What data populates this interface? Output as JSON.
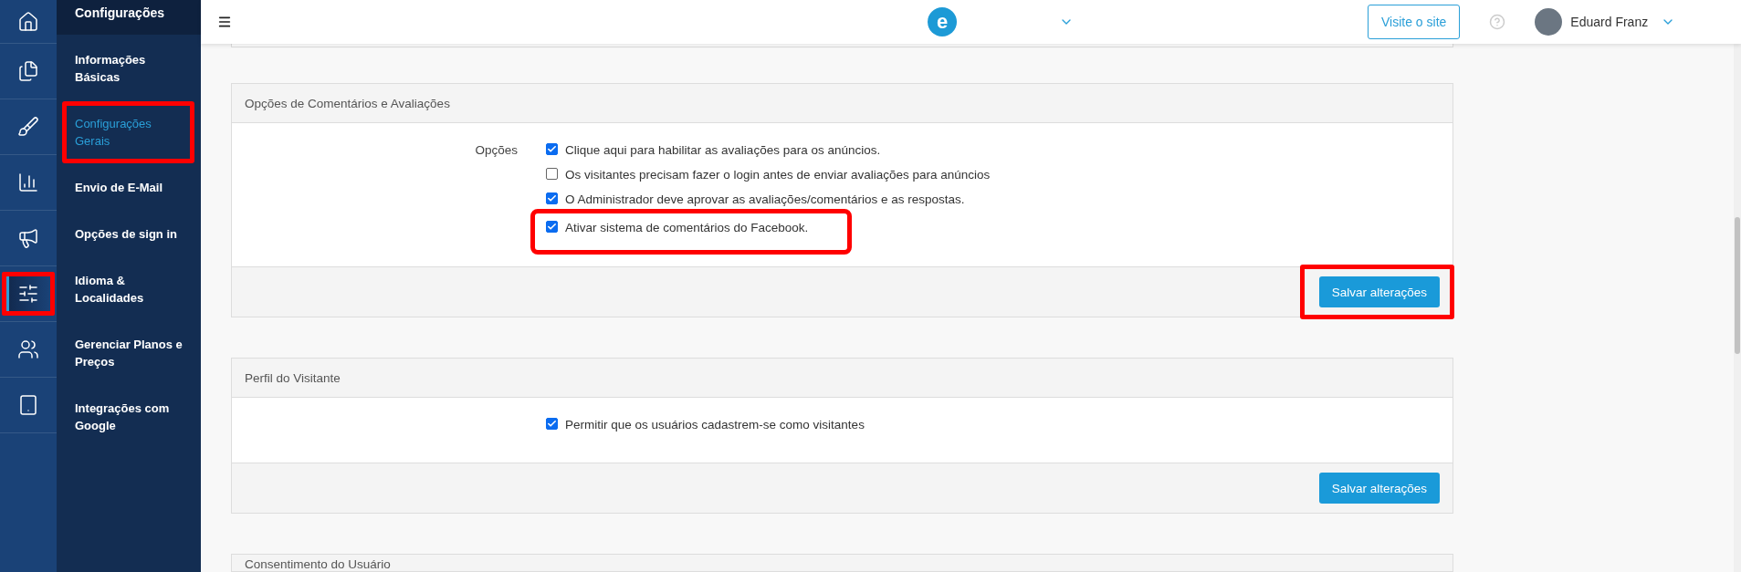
{
  "rail": [
    {
      "selected": false,
      "highlighted": false
    },
    {
      "selected": false,
      "highlighted": false
    },
    {
      "selected": false,
      "highlighted": false
    },
    {
      "selected": false,
      "highlighted": false
    },
    {
      "selected": false,
      "highlighted": false
    },
    {
      "selected": true,
      "highlighted": true
    },
    {
      "selected": false,
      "highlighted": false
    },
    {
      "selected": false,
      "highlighted": false
    }
  ],
  "sidebar": {
    "title": "Configurações",
    "items": [
      {
        "label": "Informações Básicas",
        "selected": false,
        "highlighted": false
      },
      {
        "label": "Configurações Gerais",
        "selected": true,
        "highlighted": true
      },
      {
        "label": "Envio de E-Mail",
        "selected": false,
        "highlighted": false
      },
      {
        "label": "Opções de sign in",
        "selected": false,
        "highlighted": false
      },
      {
        "label": "Idioma & Localidades",
        "selected": false,
        "highlighted": false
      },
      {
        "label": "Gerenciar Planos e Preços",
        "selected": false,
        "highlighted": false
      },
      {
        "label": "Integrações com Google",
        "selected": false,
        "highlighted": false
      }
    ]
  },
  "topbar": {
    "logo": "e",
    "visit_button": "Visite o site",
    "user_name": "Eduard Franz"
  },
  "panels": [
    {
      "title": "Opções de Comentários e Avaliações",
      "options_label": "Opções",
      "options": [
        {
          "label": "Clique aqui para habilitar as avaliações para os anúncios.",
          "checked": true,
          "highlighted": false
        },
        {
          "label": "Os visitantes precisam fazer o login antes de enviar avaliações para anúncios",
          "checked": false,
          "highlighted": false
        },
        {
          "label": "O Administrador deve aprovar as avaliações/comentários e as respostas.",
          "checked": true,
          "highlighted": false
        },
        {
          "label": "Ativar sistema de comentários do Facebook.",
          "checked": true,
          "highlighted": true
        }
      ],
      "save_button": {
        "label": "Salvar alterações",
        "highlighted": true
      }
    },
    {
      "title": "Perfil do Visitante",
      "options": [
        {
          "label": "Permitir que os usuários cadastrem-se como visitantes",
          "checked": true,
          "highlighted": false
        }
      ],
      "save_button": {
        "label": "Salvar alterações",
        "highlighted": false
      }
    }
  ],
  "partial_panel": {
    "title": "Consentimento do Usuário"
  }
}
